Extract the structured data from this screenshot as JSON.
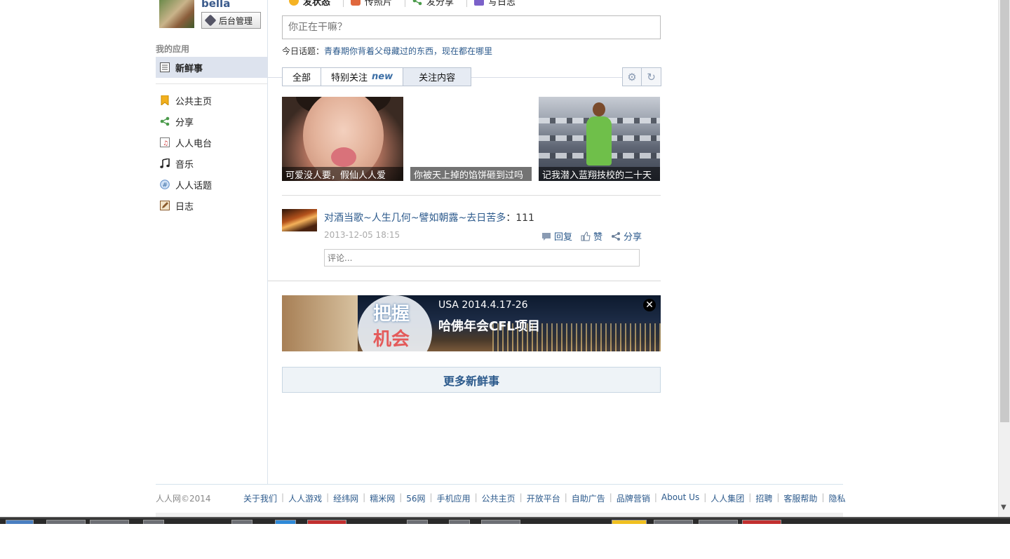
{
  "user": {
    "name": "bella",
    "admin_label": "后台管理"
  },
  "sidebar": {
    "section_title": "我的应用",
    "active_item": "新鲜事",
    "items": [
      {
        "label": "公共主页",
        "icon": "bookmark-icon"
      },
      {
        "label": "分享",
        "icon": "share-icon"
      },
      {
        "label": "人人电台",
        "icon": "radio-icon"
      },
      {
        "label": "音乐",
        "icon": "music-note-icon"
      },
      {
        "label": "人人话题",
        "icon": "topic-icon"
      },
      {
        "label": "日志",
        "icon": "edit-icon"
      }
    ]
  },
  "publish": {
    "tabs": [
      "发状态",
      "传照片",
      "发分享",
      "写日志"
    ],
    "placeholder": "你正在干嘛？"
  },
  "topic": {
    "prefix": "今日话题：",
    "link": "青春期你背着父母藏过的东西，现在都在哪里"
  },
  "filter": {
    "tabs": [
      "全部",
      "特别关注",
      "关注内容"
    ],
    "new_badge": "new"
  },
  "photos": [
    {
      "caption": "可爱没人要，假仙人人爱"
    },
    {
      "caption": "你被天上掉的馅饼砸到过吗"
    },
    {
      "caption": "记我潜入蓝翔技校的二十天"
    }
  ],
  "feed": {
    "text": "对酒当歌~人生几何~譬如朝露~去日苦多",
    "suffix": "：111",
    "time": "2013-12-05 18:15",
    "actions": {
      "reply": "回复",
      "like": "赞",
      "share": "分享"
    },
    "comment_placeholder": "评论..."
  },
  "banner": {
    "circle_line1": "把握",
    "circle_line2": "机会",
    "line1": "USA 2014.4.17-26",
    "line2": "哈佛年会CFL项目"
  },
  "more_label": "更多新鲜事",
  "footer": {
    "copyright": "人人网©2014",
    "links": [
      "关于我们",
      "人人游戏",
      "经纬网",
      "糯米网",
      "56网",
      "手机应用",
      "公共主页",
      "开放平台",
      "自助广告",
      "品牌营销",
      "About Us",
      "人人集团",
      "招聘",
      "客服帮助",
      "隐私"
    ]
  }
}
